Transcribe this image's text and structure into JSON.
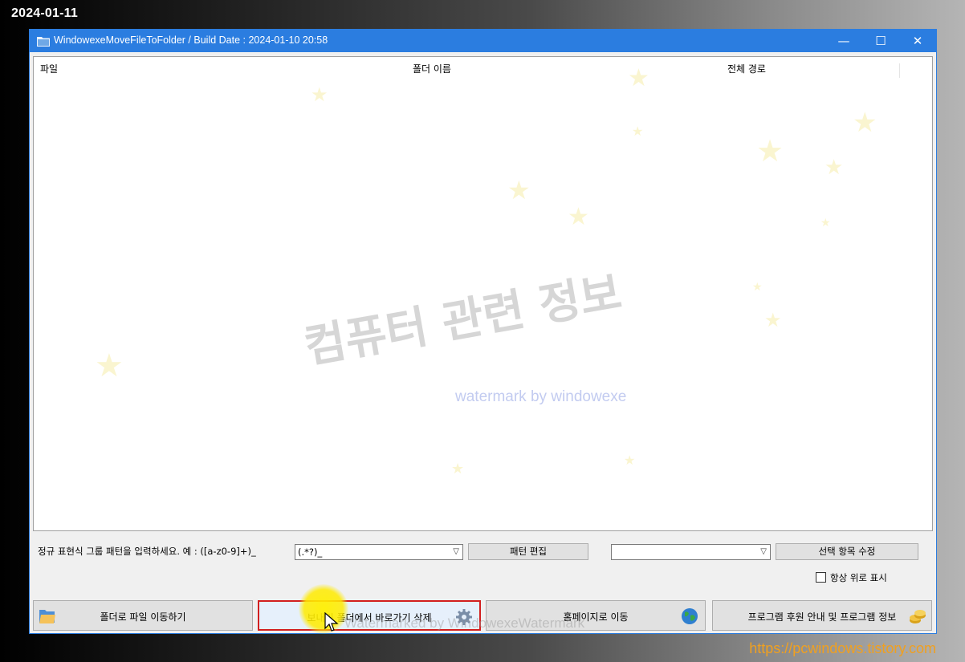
{
  "overlay": {
    "date": "2024-01-11",
    "url": "https://pcwindows.tistory.com"
  },
  "window": {
    "title": "WindowexeMoveFileToFolder / Build Date : 2024-01-10 20:58",
    "controls": {
      "minimize": "—",
      "maximize": "☐",
      "close": "✕"
    }
  },
  "list": {
    "columns": [
      "파일",
      "폴더 이름",
      "전체 경로"
    ]
  },
  "watermark": {
    "main": "컴퓨터 관련 정보",
    "sub": "watermark by windowexe",
    "button_overlay": "Watermarked by WindowexeWatermark"
  },
  "pattern": {
    "label": "정규 표현식 그룹 패턴을 입력하세요. 예 : ([a-z0-9]+)_",
    "value": "(.*?)_",
    "edit_button": "패턴 편집"
  },
  "selection": {
    "value": "",
    "edit_button": "선택 항목 수정"
  },
  "always_on_top": {
    "label": "항상 위로 표시",
    "checked": false
  },
  "buttons": {
    "move": "폴더로 파일 이동하기",
    "delete_shortcut": "보내기 폴더에서 바로가기 삭제",
    "homepage": "홈페이지로 이동",
    "info": "프로그램 후원 안내 및 프로그램 정보"
  },
  "colors": {
    "titlebar": "#2b7de0",
    "highlight_border": "#d21f1f",
    "url_text": "#f0a020"
  },
  "icons": [
    "folder-icon",
    "gear-icon",
    "globe-icon",
    "coins-icon"
  ]
}
